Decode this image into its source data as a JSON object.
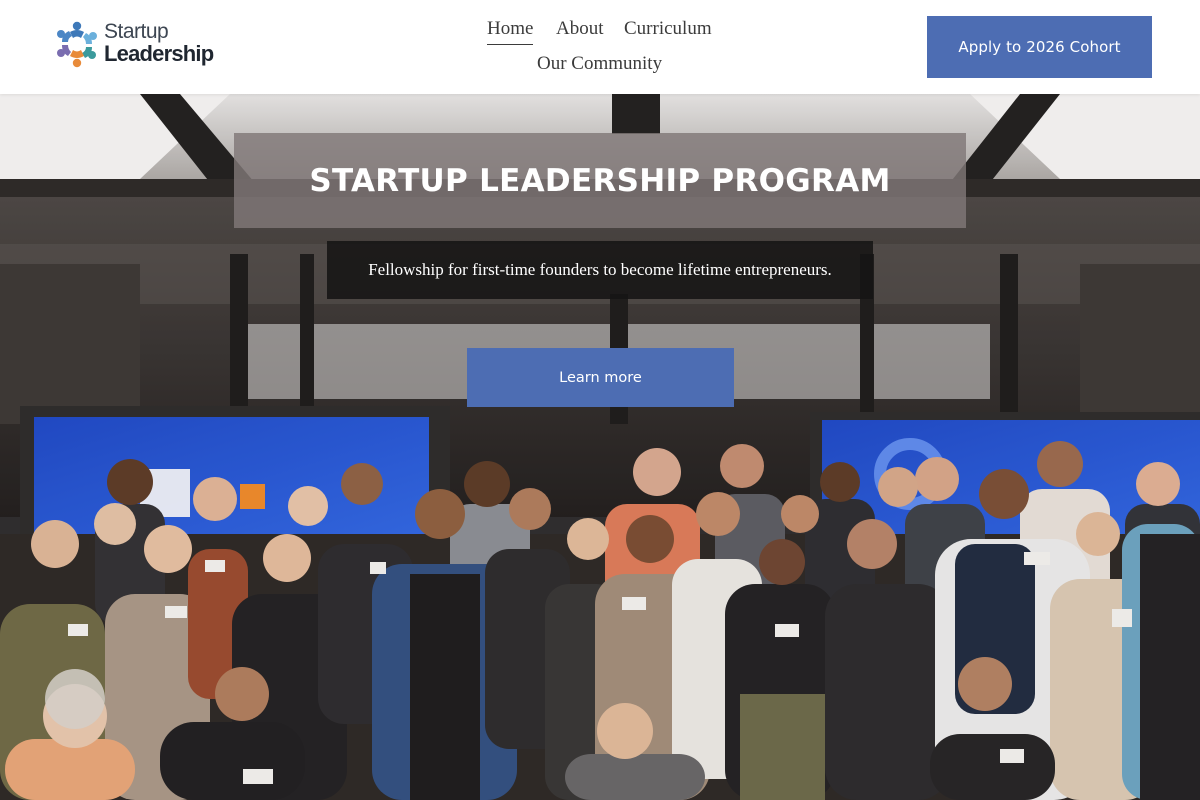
{
  "brand": {
    "logo_line1": "Startup",
    "logo_line2": "Leadership",
    "logo_colors": [
      "#3e79b9",
      "#6bb0dc",
      "#e88b3a",
      "#3b9a9c",
      "#7a6db0"
    ]
  },
  "nav": {
    "items": [
      {
        "label": "Home",
        "active": true
      },
      {
        "label": "About",
        "active": false
      },
      {
        "label": "Curriculum",
        "active": false
      },
      {
        "label": "Our Community",
        "active": false
      }
    ]
  },
  "header": {
    "cta_label": "Apply to 2026 Cohort"
  },
  "hero": {
    "title": "STARTUP LEADERSHIP PROGRAM",
    "subtitle": "Fellowship for first-time founders to become lifetime entrepreneurs.",
    "button_label": "Learn more",
    "photo_description_icon": "group-photo"
  },
  "colors": {
    "accent": "#4d6db3",
    "title_box": "#807878",
    "subtitle_box": "#161414"
  }
}
